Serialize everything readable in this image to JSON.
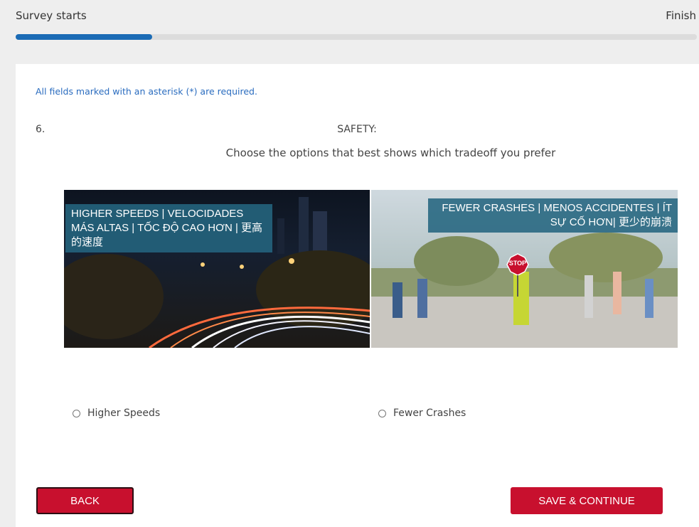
{
  "progress": {
    "start_label": "Survey starts",
    "end_label": "Finish",
    "percent": 20,
    "fill_color": "#1b6bb5"
  },
  "form": {
    "required_note": "All fields marked with an asterisk (*) are required.",
    "question_number": "6.",
    "question_title": "SAFETY:",
    "question_prompt": "Choose the options that best shows which tradeoff you prefer",
    "image": {
      "left_caption": "HIGHER SPEEDS | VELOCIDADES MÁS ALTAS | TỐC ĐỘ CAO HƠN | 更高的速度",
      "right_caption": "FEWER CRASHES | MENOS ACCIDENTES | ÍT SỰ CỐ HƠN| 更少的崩溃",
      "stop_sign_text": "STOP"
    },
    "options": [
      {
        "label": "Higher Speeds",
        "selected": false
      },
      {
        "label": "Fewer Crashes",
        "selected": false
      }
    ]
  },
  "buttons": {
    "back_label": "BACK",
    "save_label": "SAVE & CONTINUE",
    "accent_color": "#c8102e"
  }
}
